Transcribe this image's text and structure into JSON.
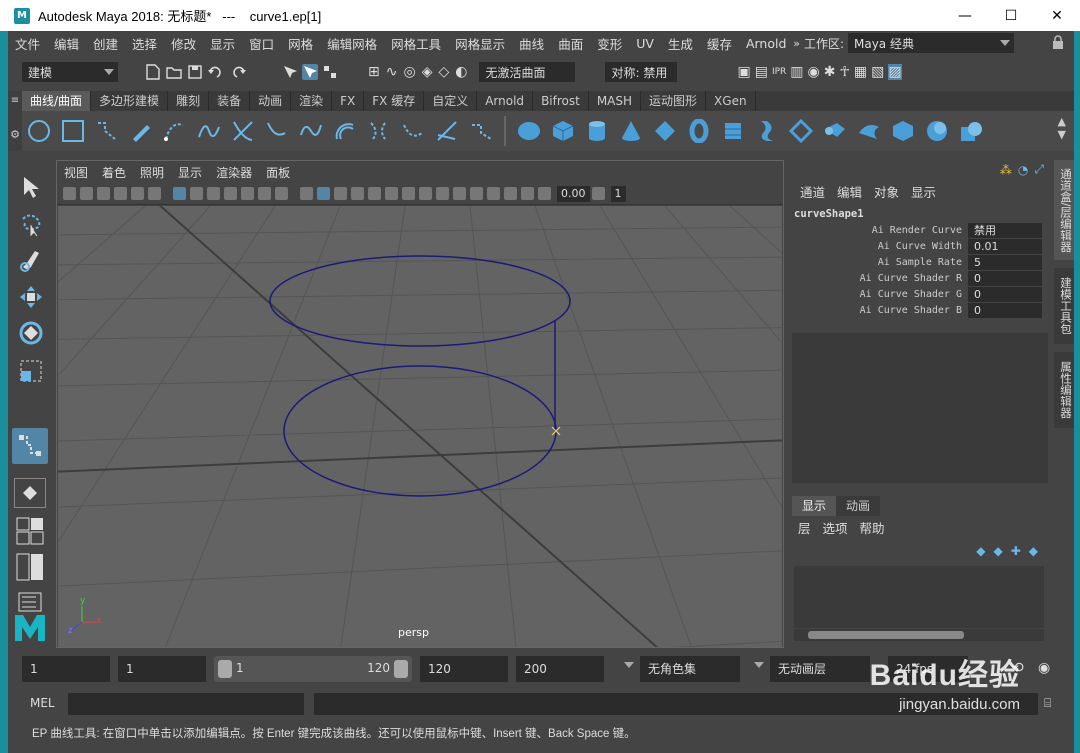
{
  "window": {
    "title": "Autodesk Maya 2018: 无标题*   ---    curve1.ep[1]",
    "logo_letter": "M",
    "minimize": "—",
    "maximize": "☐",
    "close": "✕"
  },
  "menubar": {
    "items": [
      "文件",
      "编辑",
      "创建",
      "选择",
      "修改",
      "显示",
      "窗口",
      "网格",
      "编辑网格",
      "网格工具",
      "网格显示",
      "曲线",
      "曲面",
      "变形",
      "UV",
      "生成",
      "缓存",
      "Arnold"
    ],
    "workspace_label": "工作区:",
    "workspace_value": "Maya 经典"
  },
  "statusline": {
    "mode": "建模",
    "live_surface": "无激活曲面",
    "symmetry": "对称: 禁用"
  },
  "shelf": {
    "tabs": [
      "曲线/曲面",
      "多边形建模",
      "雕刻",
      "装备",
      "动画",
      "渲染",
      "FX",
      "FX 缓存",
      "自定义",
      "Arnold",
      "Bifrost",
      "MASH",
      "运动图形",
      "XGen"
    ],
    "active_tab": 0
  },
  "viewport": {
    "menu": [
      "视图",
      "着色",
      "照明",
      "显示",
      "渲染器",
      "面板"
    ],
    "field_value": "0.00",
    "field_value2": "1",
    "camera_label": "persp",
    "axis_x": "x",
    "axis_y": "y",
    "axis_z": "z"
  },
  "channel_box": {
    "menu": [
      "通道",
      "编辑",
      "对象",
      "显示"
    ],
    "node": "curveShape1",
    "attributes": [
      {
        "name": "Ai Render Curve",
        "value": "禁用"
      },
      {
        "name": "Ai Curve Width",
        "value": "0.01"
      },
      {
        "name": "Ai Sample Rate",
        "value": "5"
      },
      {
        "name": "Ai Curve Shader R",
        "value": "0"
      },
      {
        "name": "Ai Curve Shader G",
        "value": "0"
      },
      {
        "name": "Ai Curve Shader B",
        "value": "0"
      }
    ]
  },
  "layer_editor": {
    "tabs": [
      "显示",
      "动画"
    ],
    "menu": [
      "层",
      "选项",
      "帮助"
    ]
  },
  "side_tabs": [
    "通道盒/层编辑器",
    "建模工具包",
    "属性编辑器"
  ],
  "timebar": {
    "start": "1",
    "current": "1",
    "range_start": "1",
    "range_end": "120",
    "end": "120",
    "end2": "200",
    "char_set": "无角色集",
    "anim_layer": "无动画层",
    "fps": "24 fps"
  },
  "cmdline": {
    "label": "MEL"
  },
  "helpline": {
    "text": "EP 曲线工具: 在窗口中单击以添加编辑点。按 Enter 键完成该曲线。还可以使用鼠标中键、Insert 键、Back Space 键。"
  },
  "watermark": {
    "brand": "Baidu经验",
    "url": "jingyan.baidu.com"
  },
  "colors": {
    "curve": "#1a1a7a",
    "grid": "#555555",
    "accent": "#4aa3d8",
    "frame": "#1a8e9a"
  }
}
